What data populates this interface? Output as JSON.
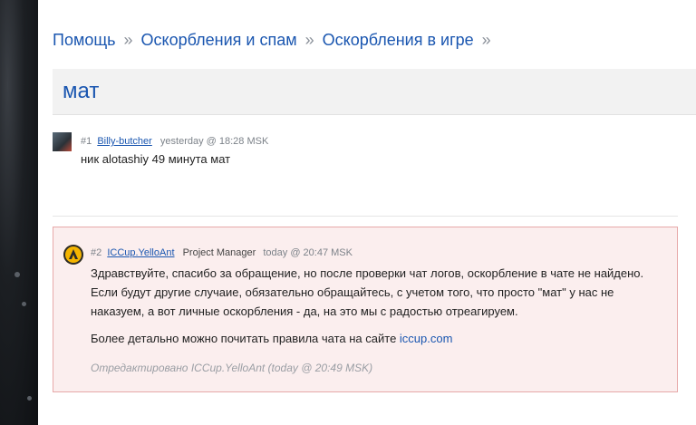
{
  "breadcrumb": {
    "items": [
      "Помощь",
      "Оскорбления и спам",
      "Оскорбления в игре"
    ],
    "separator": "»"
  },
  "topic": {
    "title": "мат"
  },
  "posts": [
    {
      "number": "#1",
      "author": "Billy-butcher",
      "role": "",
      "time": "yesterday @ 18:28 MSK",
      "text": "ник alotashiy 49 минута мат"
    },
    {
      "number": "#2",
      "author": "ICCup.YelloAnt",
      "role": "Project Manager",
      "time": "today @ 20:47 MSK",
      "paragraph1": "Здравствуйте, спасибо за обращение, но после проверки чат логов, оскорбление в чате не найдено. Если будут другие случаие, обязательно обращайтесь, с учетом того, что просто \"мат\" у нас не наказуем, а вот личные оскорбления - да, на это мы с радостью отреагируем.",
      "paragraph2_text": "Более детально можно почитать правила чата на сайте",
      "link": "iccup.com",
      "edited": "Отредактировано ICCup.YelloAnt (today @ 20:49 MSK)"
    }
  ],
  "colors": {
    "link": "#1a56b0",
    "highlight_bg": "#fbeeee",
    "highlight_border": "#e7a9a9"
  }
}
